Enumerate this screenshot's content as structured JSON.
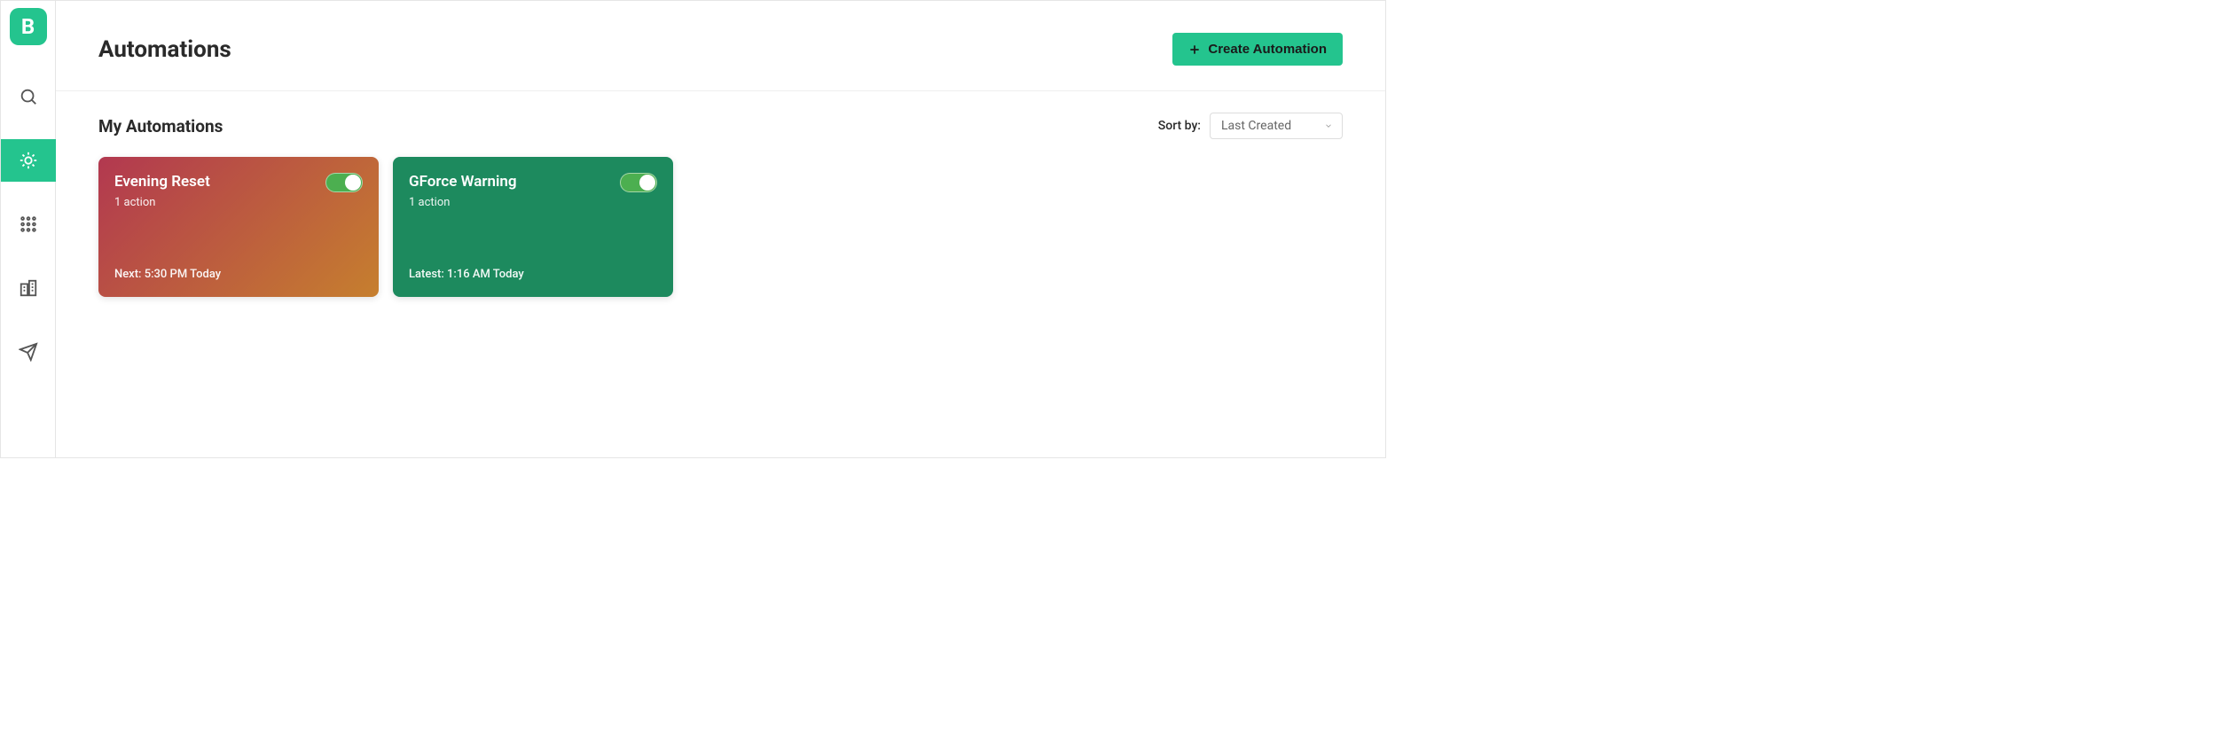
{
  "header": {
    "title": "Automations",
    "create_button": "Create Automation"
  },
  "section": {
    "title": "My Automations",
    "sort_label": "Sort by:",
    "sort_value": "Last Created"
  },
  "cards": [
    {
      "title": "Evening Reset",
      "actions": "1 action",
      "footer": "Next: 5:30 PM Today",
      "enabled": true,
      "style": "gradient"
    },
    {
      "title": "GForce Warning",
      "actions": "1 action",
      "footer": "Latest: 1:16 AM Today",
      "enabled": true,
      "style": "green"
    }
  ],
  "logo_letter": "B"
}
